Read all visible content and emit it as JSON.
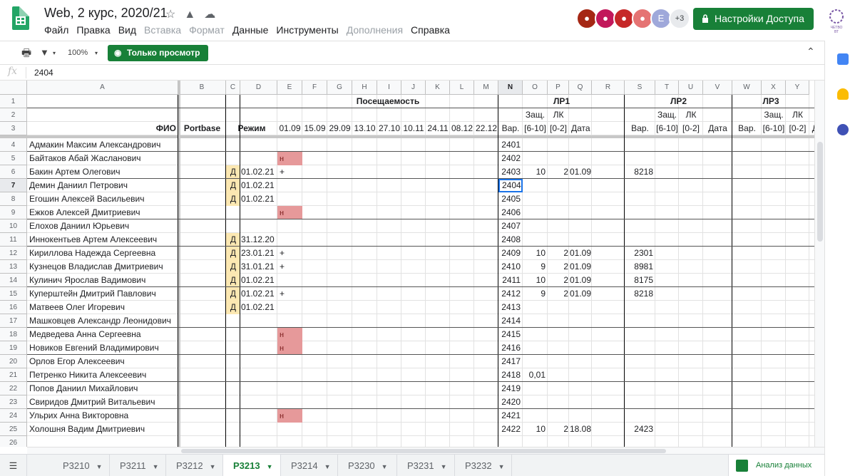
{
  "title": "Web, 2 курс, 2020/21",
  "menu": [
    "Файл",
    "Правка",
    "Вид",
    "Вставка",
    "Формат",
    "Данные",
    "Инструменты",
    "Дополнения",
    "Справка"
  ],
  "menu_disabled": [
    "Вставка",
    "Формат",
    "Дополнения"
  ],
  "avatars_more": "+3",
  "avatar_letter": "E",
  "share_label": "Настройки Доступа",
  "brand_text": "ЧЕТВО ВТ",
  "toolbar": {
    "zoom": "100%",
    "view_only": "Только просмотр"
  },
  "formula_bar": {
    "fx": "fx",
    "value": "2404"
  },
  "columns": [
    "A",
    "B",
    "C",
    "D",
    "E",
    "F",
    "G",
    "H",
    "I",
    "J",
    "K",
    "L",
    "M",
    "N",
    "O",
    "P",
    "Q",
    "R",
    "S",
    "T",
    "U",
    "V",
    "W",
    "X",
    "Y"
  ],
  "row_numbers": [
    "1",
    "2",
    "3",
    "4",
    "5",
    "6",
    "7",
    "8",
    "9",
    "10",
    "11",
    "12",
    "13",
    "14",
    "15",
    "16",
    "17",
    "18",
    "19",
    "20",
    "21",
    "22",
    "23",
    "24",
    "25",
    "26"
  ],
  "headers": {
    "attendance": "Посещаемость",
    "lr1": "ЛР1",
    "lr2": "ЛР2",
    "lr3": "ЛР3",
    "protect": "Защ.",
    "lk": "ЛК",
    "fio": "ФИО",
    "portbase": "Portbase",
    "mode": "Режим",
    "dates": [
      "01.09",
      "15.09",
      "29.09",
      "13.10",
      "27.10",
      "10.11",
      "24.11",
      "08.12",
      "22.12"
    ],
    "var": "Вар.",
    "range610": "[6-10]",
    "range02": "[0-2]",
    "date": "Дата"
  },
  "students": [
    {
      "name": "Адмакин Максим Александрович",
      "var": "2401"
    },
    {
      "name": "Байтаков Абай Жасланович",
      "var": "2402",
      "e": "н"
    },
    {
      "name": "Бакин Артем Олегович",
      "mode": "Д",
      "mode_date": "01.02.21",
      "e": "+",
      "var": "2403",
      "o": "10",
      "p": "2",
      "q": "01.09",
      "r": "8218"
    },
    {
      "name": "Демин Даниил Петрович",
      "mode": "Д",
      "mode_date": "01.02.21",
      "var": "2404"
    },
    {
      "name": "Егошин Алексей Васильевич",
      "mode": "Д",
      "mode_date": "01.02.21",
      "var": "2405"
    },
    {
      "name": "Ежков Алексей Дмитриевич",
      "var": "2406",
      "e": "н"
    },
    {
      "name": "Елохов Даниил Юрьевич",
      "var": "2407"
    },
    {
      "name": "Иннокентьев Артем Алексеевич",
      "mode": "Д",
      "mode_date": "31.12.20",
      "var": "2408"
    },
    {
      "name": "Кириллова Надежда Сергеевна",
      "mode": "Д",
      "mode_date": "23.01.21",
      "e": "+",
      "var": "2409",
      "o": "10",
      "p": "2",
      "q": "01.09",
      "r": "2301"
    },
    {
      "name": "Кузнецов Владислав Дмитриевич",
      "mode": "Д",
      "mode_date": "31.01.21",
      "e": "+",
      "var": "2410",
      "o": "9",
      "p": "2",
      "q": "01.09",
      "r": "8981"
    },
    {
      "name": "Кулинич Ярослав Вадимович",
      "mode": "Д",
      "mode_date": "01.02.21",
      "var": "2411",
      "o": "10",
      "p": "2",
      "q": "01.09",
      "r": "8175"
    },
    {
      "name": "Куперштейн Дмитрий Павлович",
      "mode": "Д",
      "mode_date": "01.02.21",
      "e": "+",
      "var": "2412",
      "o": "9",
      "p": "2",
      "q": "01.09",
      "r": "8218"
    },
    {
      "name": "Матвеев Олег Игоревич",
      "mode": "Д",
      "mode_date": "01.02.21",
      "var": "2413"
    },
    {
      "name": "Машковцев Александр Леонидович",
      "var": "2414"
    },
    {
      "name": "Медведева Анна Сергеевна",
      "var": "2415",
      "e": "н"
    },
    {
      "name": "Новиков Евгений Владимирович",
      "var": "2416",
      "e": "н"
    },
    {
      "name": "Орлов Егор Алексеевич",
      "var": "2417"
    },
    {
      "name": "Петренко Никита Алексеевич",
      "var": "2418",
      "o": "0,01"
    },
    {
      "name": "Попов Даниил Михайлович",
      "var": "2419"
    },
    {
      "name": "Свиридов Дмитрий Витальевич",
      "var": "2420"
    },
    {
      "name": "Ульрих Анна Викторовна",
      "var": "2421",
      "e": "н"
    },
    {
      "name": "Холошня Вадим Дмитриевич",
      "var": "2422",
      "o": "10",
      "p": "2",
      "q": "18.08",
      "r": "2423"
    }
  ],
  "tabs": [
    "P3210",
    "P3211",
    "P3212",
    "P3213",
    "P3214",
    "P3230",
    "P3231",
    "P3232"
  ],
  "active_tab": "P3213",
  "explore_label": "Анализ данных",
  "colors": {
    "green": "#188038",
    "absent": "#e6999a",
    "mode_yellow": "#fce8b2",
    "selected": "#1a73e8"
  }
}
